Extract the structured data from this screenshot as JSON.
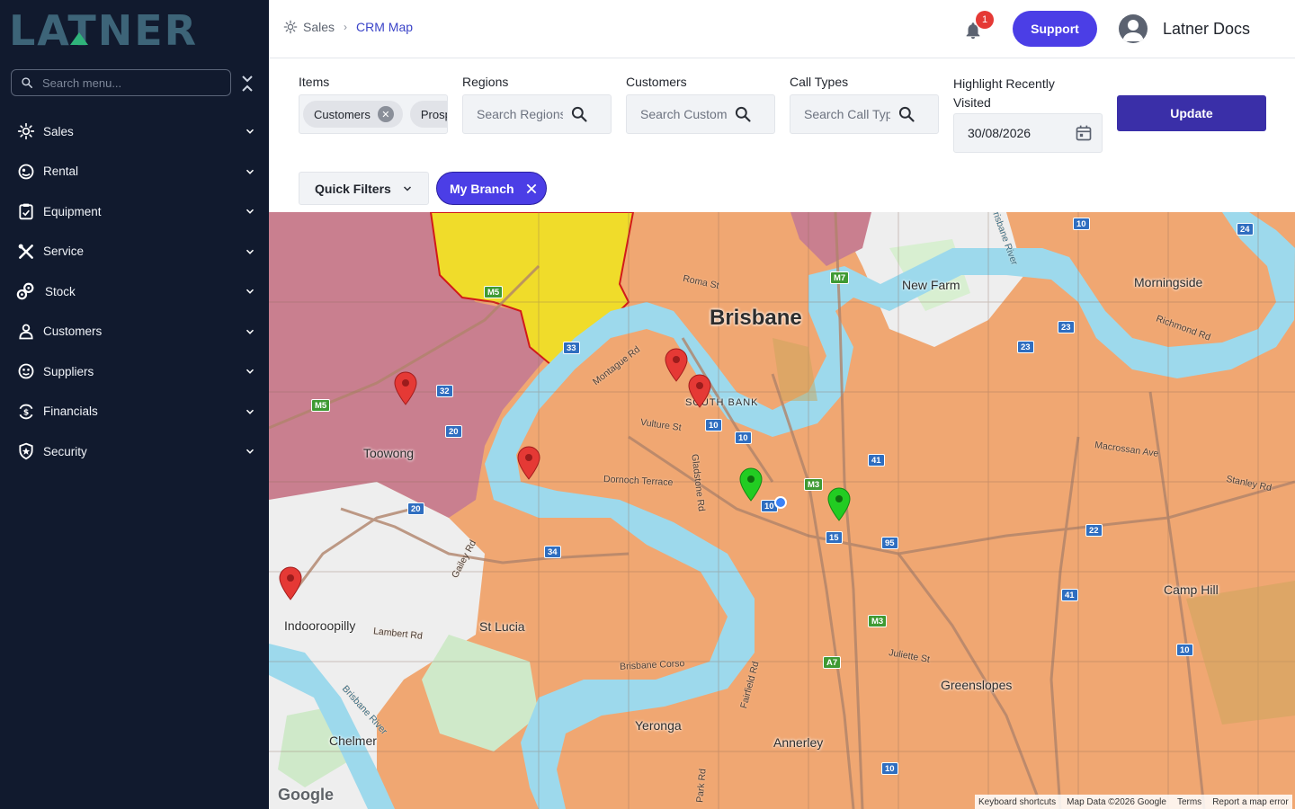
{
  "app": {
    "logo": "LATNER"
  },
  "sidebar": {
    "search_placeholder": "Search menu...",
    "items": [
      {
        "label": "Sales",
        "icon": "sales-icon"
      },
      {
        "label": "Rental",
        "icon": "rental-icon"
      },
      {
        "label": "Equipment",
        "icon": "clipboard-icon"
      },
      {
        "label": "Service",
        "icon": "tools-icon"
      },
      {
        "label": "Stock",
        "icon": "parts-icon"
      },
      {
        "label": "Customers",
        "icon": "person-icon"
      },
      {
        "label": "Suppliers",
        "icon": "supplier-icon"
      },
      {
        "label": "Financials",
        "icon": "money-icon"
      },
      {
        "label": "Security",
        "icon": "shield-icon"
      }
    ]
  },
  "header": {
    "breadcrumb": {
      "root": "Sales",
      "current": "CRM Map"
    },
    "notifications_count": "1",
    "support_label": "Support",
    "user_name": "Latner Docs"
  },
  "filters": {
    "items_label": "Items",
    "items_chips": [
      "Customers",
      "Prosp"
    ],
    "regions_label": "Regions",
    "regions_placeholder": "Search Regions",
    "customers_label": "Customers",
    "customers_placeholder": "Search Custome",
    "calltypes_label": "Call Types",
    "calltypes_placeholder": "Search Call Type",
    "highlight_label": "Highlight Recently Visited",
    "highlight_date": "30/08/2026",
    "update_label": "Update",
    "quick_filters_label": "Quick Filters",
    "branch_chip_label": "My Branch"
  },
  "map": {
    "places": {
      "brisbane": "Brisbane",
      "new_farm": "New Farm",
      "morningside": "Morningside",
      "south_bank": "SOUTH BANK",
      "toowong": "Toowong",
      "indooroopilly": "Indooroopilly",
      "st_lucia": "St Lucia",
      "camp_hill": "Camp Hill",
      "greenslopes": "Greenslopes",
      "yeronga": "Yeronga",
      "annerley": "Annerley",
      "chelmer": "Chelmer"
    },
    "streets": {
      "roma": "Roma St",
      "montague": "Montague Rd",
      "vulture": "Vulture St",
      "dornoch": "Dornoch Terrace",
      "gladstone": "Gladstone Rd",
      "gailey": "Gailey Rd",
      "lambert": "Lambert Rd",
      "brisbane_corso": "Brisbane Corso",
      "fairfield": "Fairfield Rd",
      "park": "Park Rd",
      "juliette": "Juliette St",
      "macrossan": "Macrossan Ave",
      "stanley": "Stanley Rd",
      "richmond": "Richmond Rd",
      "brisbane_river": "Brisbane River",
      "brisbane_river_top": "Brisbane River"
    },
    "route_shields": [
      "M5",
      "M5",
      "32",
      "20",
      "20",
      "33",
      "10",
      "10",
      "10",
      "M3",
      "M7",
      "41",
      "15",
      "95",
      "34",
      "22",
      "41",
      "10",
      "23",
      "23",
      "24",
      "10",
      "A7",
      "M3",
      "10"
    ],
    "google": "Google",
    "attribution": [
      "Keyboard shortcuts",
      "Map Data ©2026 Google",
      "Terms",
      "Report a map error"
    ],
    "colors": {
      "region_pink": "#c97f8f",
      "region_yellow": "#f0dc2a",
      "territory_orange": "#f0a772",
      "water": "#9dd9ec",
      "pin_red": "#e53935",
      "pin_green": "#22cc22"
    }
  }
}
